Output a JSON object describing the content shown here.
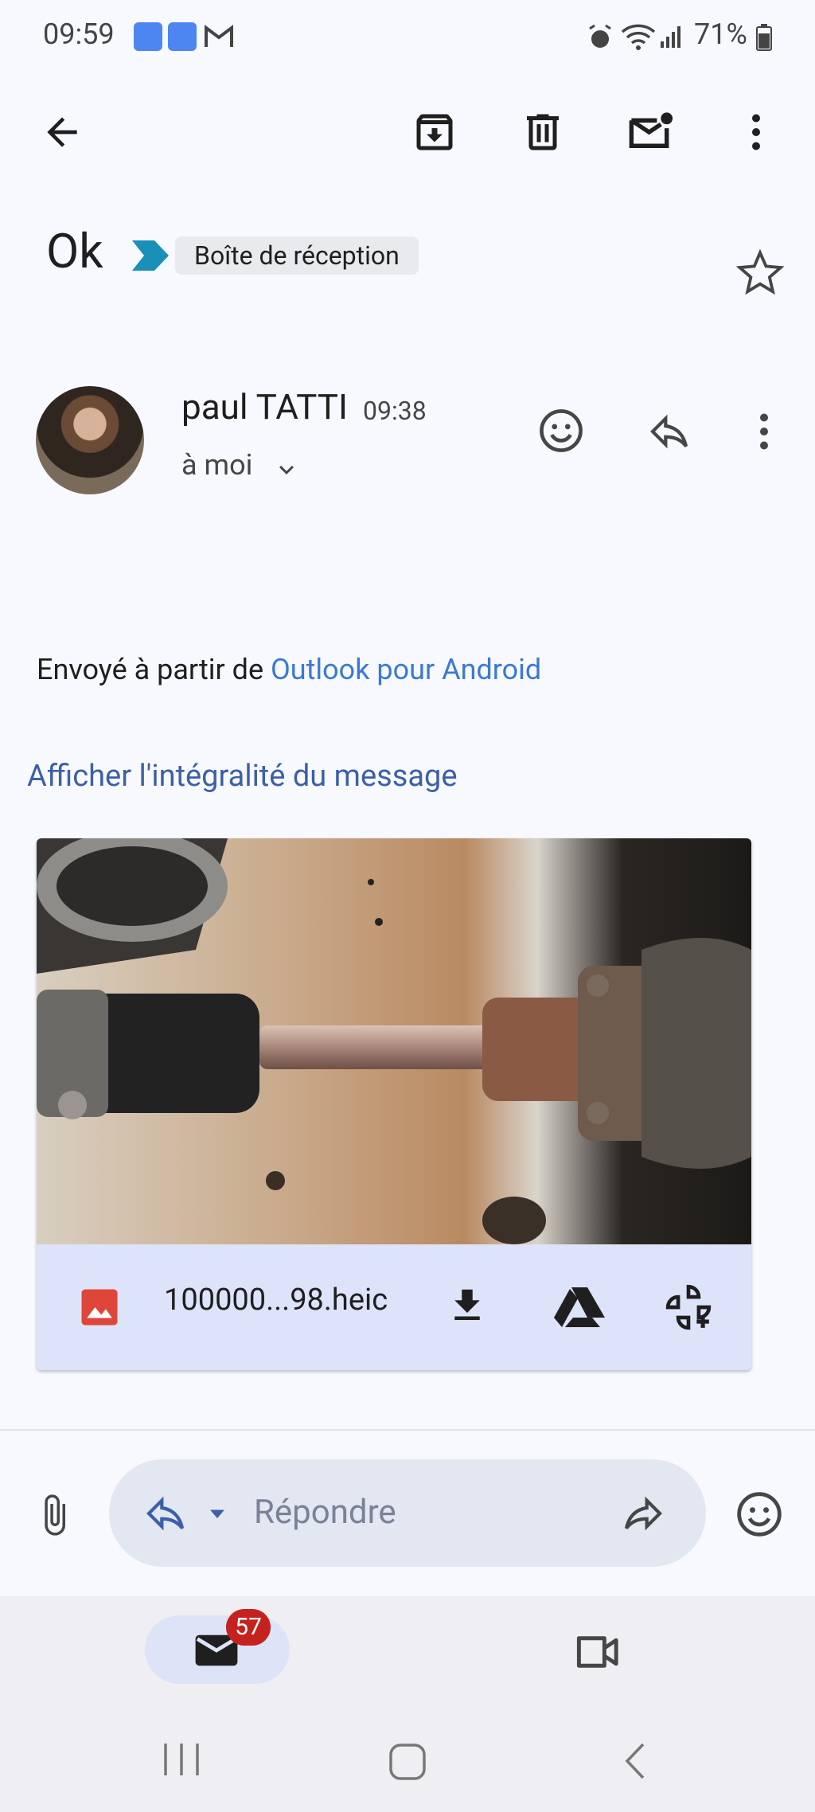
{
  "status_bar": {
    "time": "09:59",
    "battery": "71%"
  },
  "toolbar": {
    "icons": [
      "back-arrow-icon",
      "archive-icon",
      "delete-icon",
      "mark-unread-icon",
      "more-vert-icon"
    ]
  },
  "email": {
    "subject": "Ok",
    "label": "Boîte de réception",
    "sender_name": "paul TATTI",
    "time": "09:38",
    "recipient": "à moi",
    "body_prefix": "Envoyé à partir de ",
    "body_link": "Outlook pour Android",
    "show_full_message": "Afficher l'intégralité du message"
  },
  "attachment": {
    "file_name": "100000...98.heic"
  },
  "reply_bar": {
    "placeholder": "Répondre"
  },
  "bottom_nav": {
    "mail_badge": "57"
  },
  "colors": {
    "accent_blue": "#3b79d4",
    "badge_red": "#c5221f",
    "important_marker": "#1a8fb7"
  }
}
